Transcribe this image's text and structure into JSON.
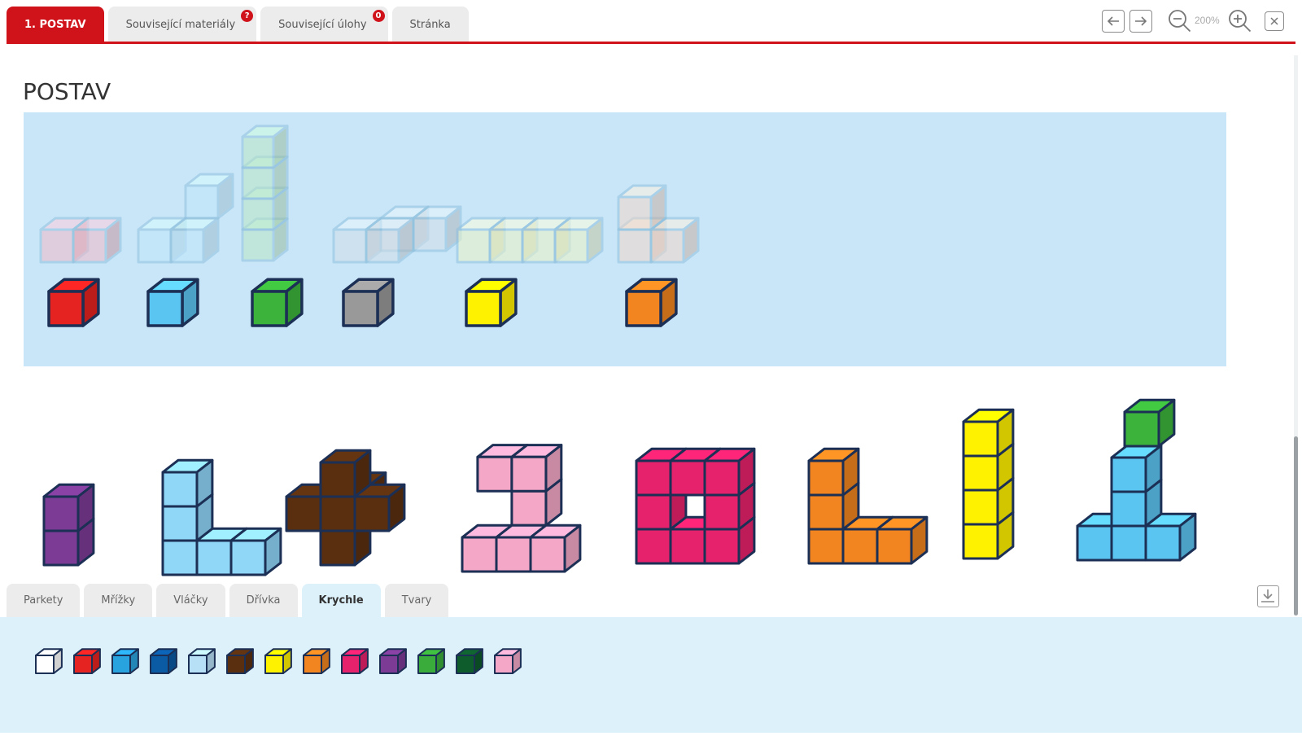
{
  "tabs": [
    {
      "label": "1. POSTAV",
      "active": true
    },
    {
      "label": "Související materiály",
      "badge": "?"
    },
    {
      "label": "Související úlohy",
      "badge": "0"
    },
    {
      "label": "Stránka"
    }
  ],
  "toolbar": {
    "back_icon": "arrow-left-icon",
    "forward_icon": "arrow-right-icon",
    "zoom_out_icon": "zoom-out-icon",
    "zoom_level": "200%",
    "zoom_in_icon": "zoom-in-icon",
    "close_icon": "close-icon"
  },
  "page_title": "POSTAV",
  "bottom_tabs": [
    {
      "label": "Parkety"
    },
    {
      "label": "Mřížky"
    },
    {
      "label": "Vláčky"
    },
    {
      "label": "Dřívka"
    },
    {
      "label": "Krychle",
      "active": true
    },
    {
      "label": "Tvary"
    }
  ],
  "download_icon": "download-icon",
  "palette": [
    "#ffffff",
    "#e52321",
    "#29a3df",
    "#0b5aa4",
    "#b7dff5",
    "#5a2f10",
    "#fff200",
    "#f28520",
    "#e6226d",
    "#7c3b95",
    "#3aac3b",
    "#0e5b2b",
    "#f4a7c7"
  ],
  "colors": {
    "accent": "#d0121b",
    "panel": "#c9e6f8",
    "outline": "#1c2f55",
    "red": "#e52321",
    "light_blue": "#5bc5f2",
    "green": "#3cb43c",
    "gray": "#999999",
    "yellow": "#fff200",
    "orange": "#f28520",
    "purple": "#7c3b95",
    "brown": "#5a2f10",
    "pink": "#f4a7c7",
    "magenta": "#e6226d"
  }
}
